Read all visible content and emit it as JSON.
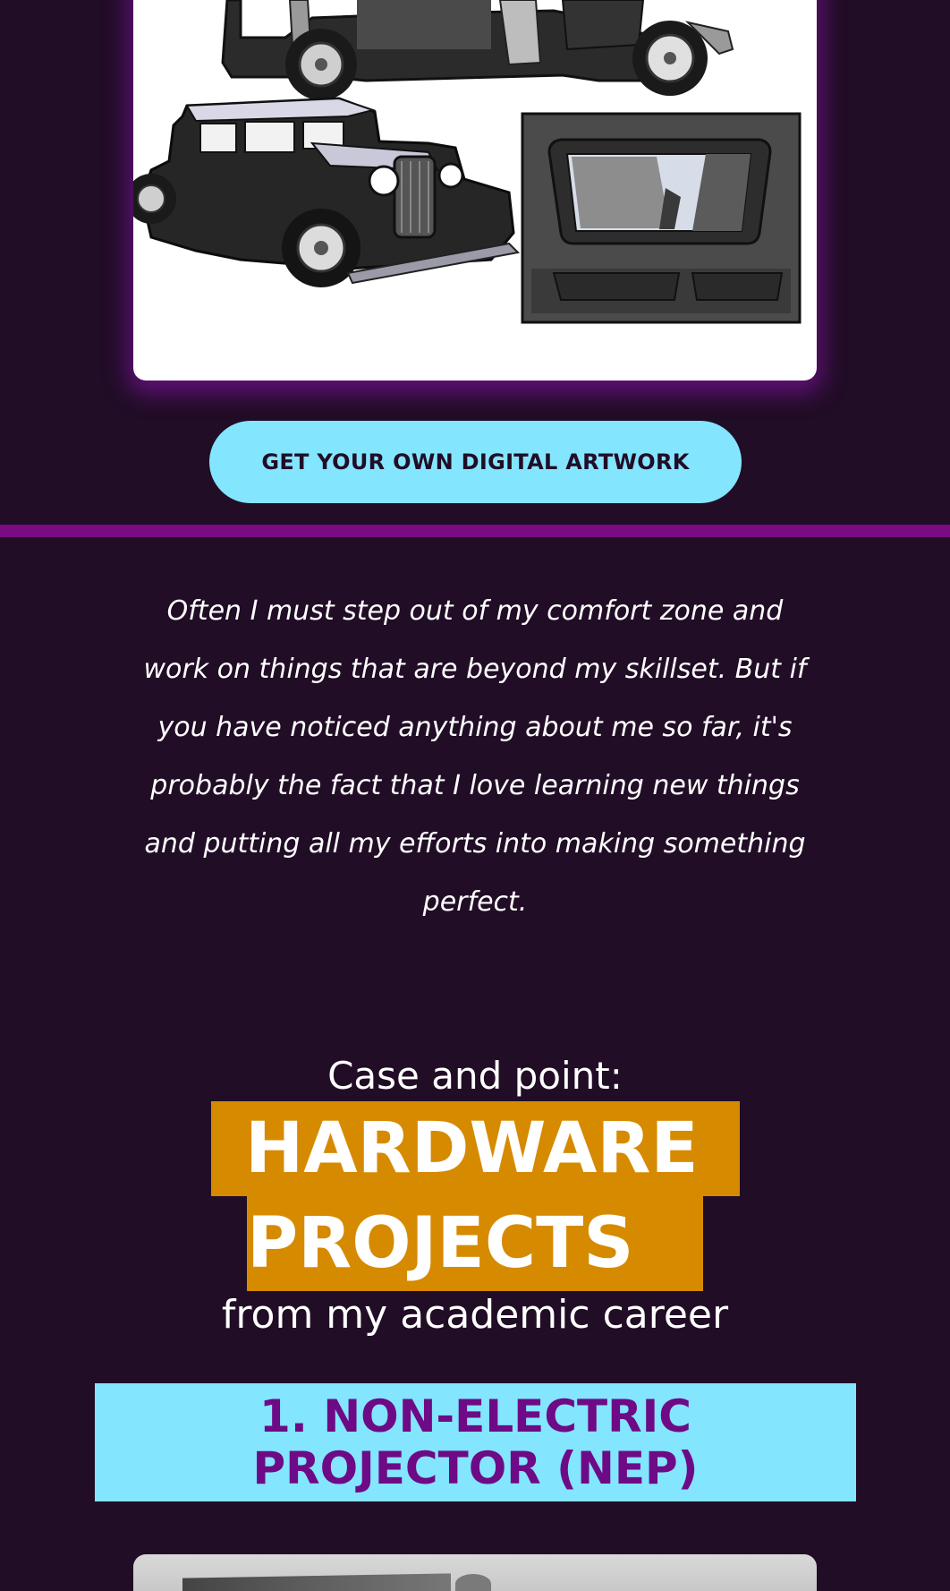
{
  "artwork": {
    "panel_1": "car-side-view-doors-open",
    "panel_2": "car-front-three-quarter-view",
    "panel_3": "sunroof-view-of-skyscrapers"
  },
  "cta": {
    "label": "GET YOUR OWN DIGITAL ARTWORK"
  },
  "quote": {
    "text": "Often I must step out of my comfort zone and work on things that are beyond my skillset. But if you have noticed anything about me so far, it's probably the fact that I love learning new things and putting all my efforts into making something perfect."
  },
  "heading": {
    "intro": "Case and point:",
    "highlight_line_1": "HARDWARE",
    "highlight_line_2": "PROJECTS",
    "outro": "from my academic career"
  },
  "project": {
    "title": "1. NON-ELECTRIC PROJECTOR (NEP)"
  },
  "colors": {
    "background": "#210d26",
    "accent_cyan": "#84e5ff",
    "accent_purple": "#7a0b82",
    "highlight_orange": "#d68a00",
    "title_purple": "#6e0a86"
  }
}
